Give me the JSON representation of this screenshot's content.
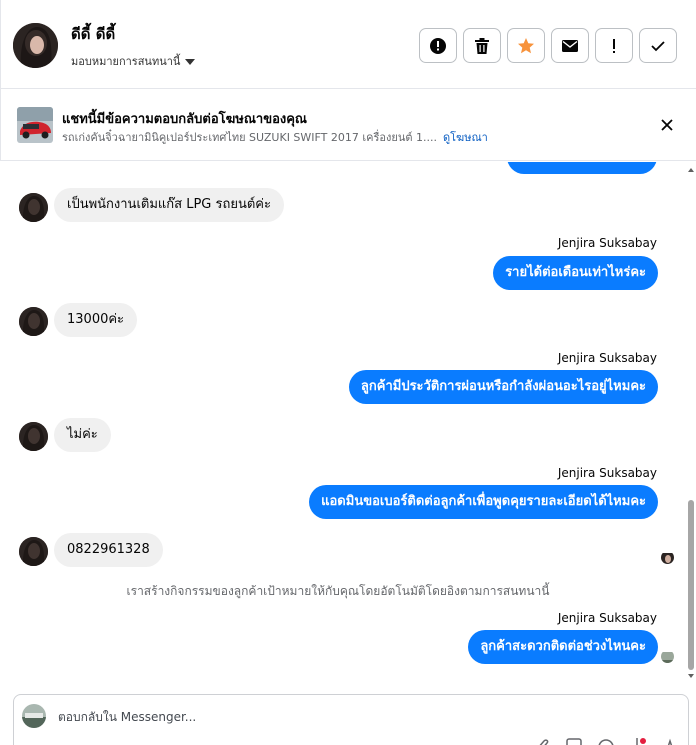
{
  "header": {
    "contact_name": "ดีดี้ ดีดี้",
    "assign_label": "มอบหมายการสนทนานี้",
    "actions": [
      {
        "icon": "alert-circle-icon"
      },
      {
        "icon": "trash-icon"
      },
      {
        "icon": "star-icon",
        "color": "#f7923b"
      },
      {
        "icon": "mail-icon"
      },
      {
        "icon": "exclamation-icon"
      },
      {
        "icon": "check-icon"
      }
    ]
  },
  "ad_banner": {
    "title": "แชทนี้มีข้อความตอบกลับต่อโฆษณาของคุณ",
    "subtitle": "รถเก่งคันจิ๋วฉายามินิคูเปอร์ประเทศไทย SUZUKI SWIFT 2017 เครื่องยนต์ 1....",
    "link": "ดูโฆษณา"
  },
  "messages": {
    "in_1": "เป็นพนักงานเติมแก๊ส LPG รถยนต์ค่ะ",
    "sender_1": "Jenjira Suksabay",
    "out_1": "รายได้ต่อเดือนเท่าไหร่คะ",
    "in_2": "13000ค่ะ",
    "sender_2": "Jenjira Suksabay",
    "out_2": "ลูกค้ามีประวัติการผ่อนหรือกำลังผ่อนอะไรอยู่ไหมคะ",
    "in_3": "ไม่ค่ะ",
    "sender_3": "Jenjira Suksabay",
    "out_3": "แอดมินขอเบอร์ติดต่อลูกค้าเพื่อพูดคุยรายละเอียดได้ไหมคะ",
    "in_4": "0822961328",
    "system_note": "เราสร้างกิจกรรมของลูกค้าเป้าหมายให้กับคุณโดยอัตโนมัติโดยอิงตามการสนทนานี้",
    "sender_4": "Jenjira Suksabay",
    "out_4": "ลูกค้าสะดวกติดต่อช่วงไหนคะ"
  },
  "composer": {
    "placeholder": "ตอบกลับใน Messenger..."
  },
  "colors": {
    "accent": "#0a7cff",
    "incoming_bubble": "#f0f0f0",
    "link": "#0a5dc2"
  }
}
